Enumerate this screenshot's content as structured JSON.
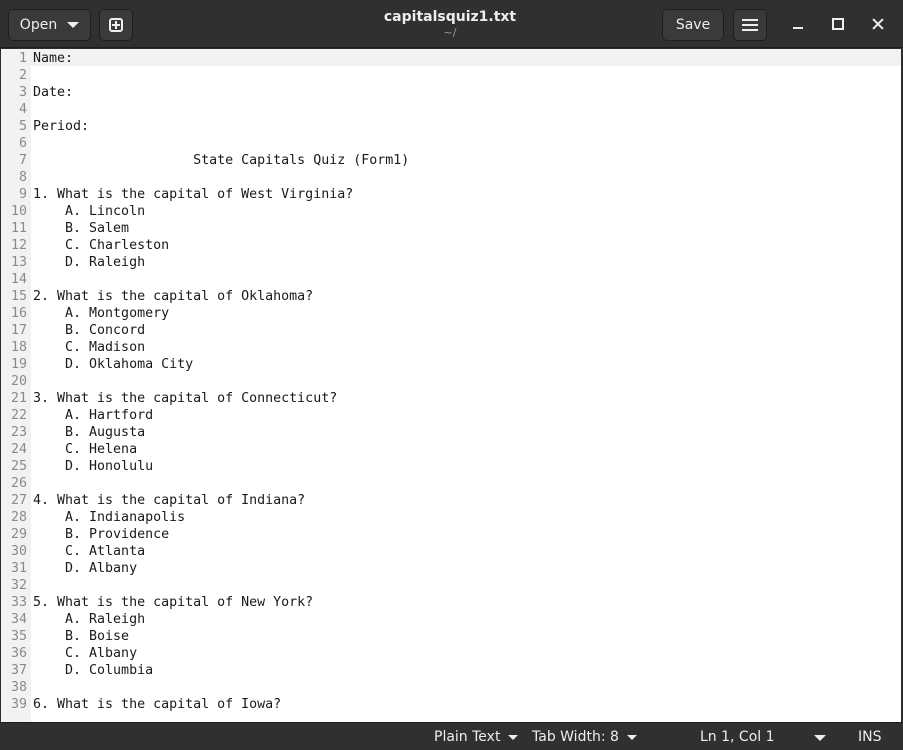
{
  "header": {
    "open_label": "Open",
    "title": "capitalsquiz1.txt",
    "subtitle": "~/",
    "save_label": "Save"
  },
  "editor": {
    "lines": [
      {
        "n": "1",
        "text": "Name:"
      },
      {
        "n": "2",
        "text": ""
      },
      {
        "n": "3",
        "text": "Date:"
      },
      {
        "n": "4",
        "text": ""
      },
      {
        "n": "5",
        "text": "Period:"
      },
      {
        "n": "6",
        "text": ""
      },
      {
        "n": "7",
        "text": "                    State Capitals Quiz (Form1)"
      },
      {
        "n": "8",
        "text": ""
      },
      {
        "n": "9",
        "text": "1. What is the capital of West Virginia?"
      },
      {
        "n": "10",
        "text": "    A. Lincoln"
      },
      {
        "n": "11",
        "text": "    B. Salem"
      },
      {
        "n": "12",
        "text": "    C. Charleston"
      },
      {
        "n": "13",
        "text": "    D. Raleigh"
      },
      {
        "n": "14",
        "text": ""
      },
      {
        "n": "15",
        "text": "2. What is the capital of Oklahoma?"
      },
      {
        "n": "16",
        "text": "    A. Montgomery"
      },
      {
        "n": "17",
        "text": "    B. Concord"
      },
      {
        "n": "18",
        "text": "    C. Madison"
      },
      {
        "n": "19",
        "text": "    D. Oklahoma City"
      },
      {
        "n": "20",
        "text": ""
      },
      {
        "n": "21",
        "text": "3. What is the capital of Connecticut?"
      },
      {
        "n": "22",
        "text": "    A. Hartford"
      },
      {
        "n": "23",
        "text": "    B. Augusta"
      },
      {
        "n": "24",
        "text": "    C. Helena"
      },
      {
        "n": "25",
        "text": "    D. Honolulu"
      },
      {
        "n": "26",
        "text": ""
      },
      {
        "n": "27",
        "text": "4. What is the capital of Indiana?"
      },
      {
        "n": "28",
        "text": "    A. Indianapolis"
      },
      {
        "n": "29",
        "text": "    B. Providence"
      },
      {
        "n": "30",
        "text": "    C. Atlanta"
      },
      {
        "n": "31",
        "text": "    D. Albany"
      },
      {
        "n": "32",
        "text": ""
      },
      {
        "n": "33",
        "text": "5. What is the capital of New York?"
      },
      {
        "n": "34",
        "text": "    A. Raleigh"
      },
      {
        "n": "35",
        "text": "    B. Boise"
      },
      {
        "n": "36",
        "text": "    C. Albany"
      },
      {
        "n": "37",
        "text": "    D. Columbia"
      },
      {
        "n": "38",
        "text": ""
      },
      {
        "n": "39",
        "text": "6. What is the capital of Iowa?"
      }
    ]
  },
  "statusbar": {
    "language": "Plain Text",
    "tab_width": "Tab Width: 8",
    "cursor_position": "Ln 1, Col 1",
    "insert_mode": "INS"
  }
}
